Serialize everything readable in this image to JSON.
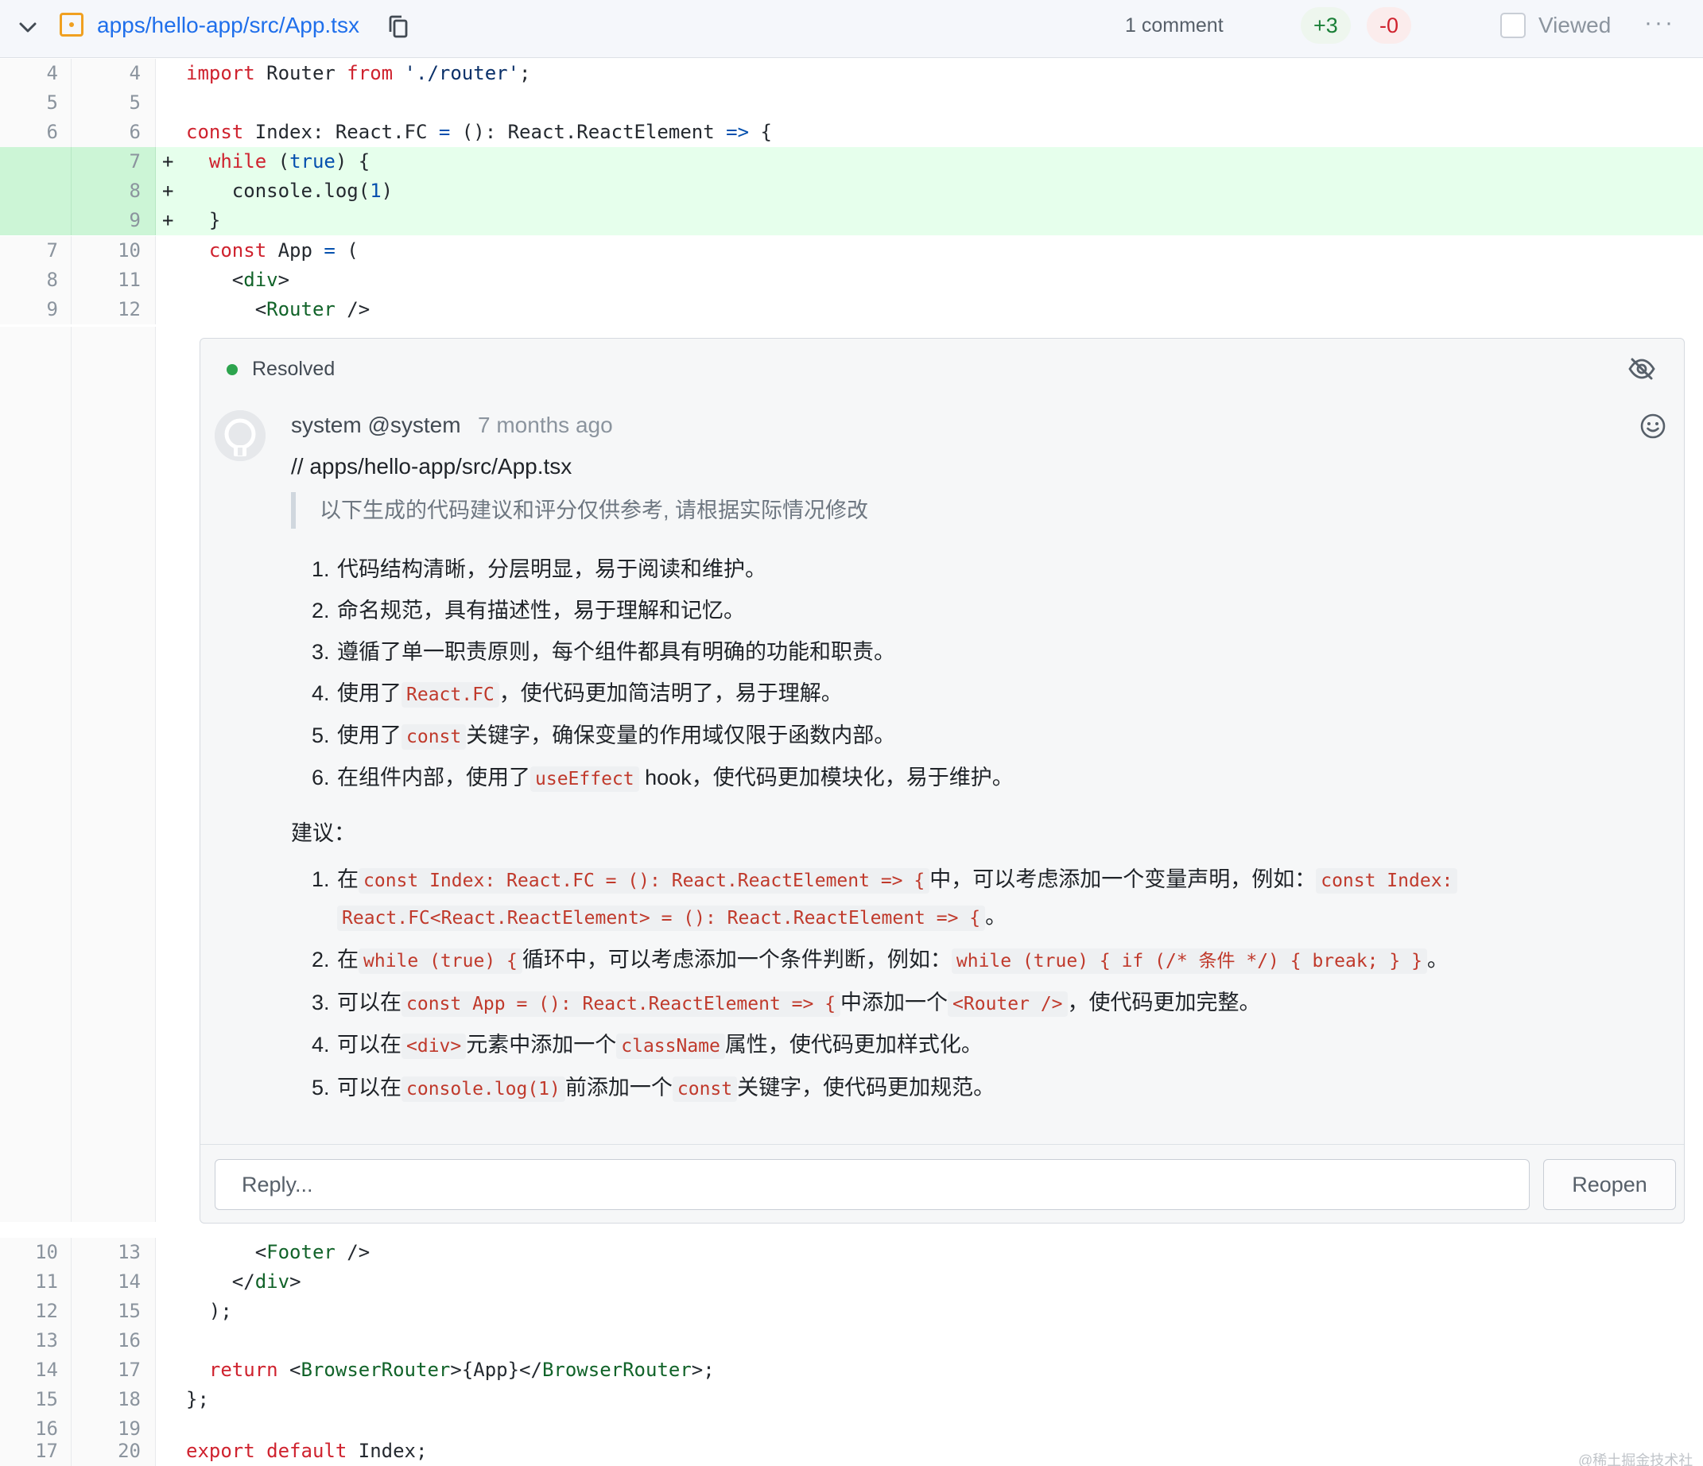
{
  "header": {
    "file_path": "apps/hello-app/src/App.tsx",
    "comments": "1 comment",
    "additions": "+3",
    "deletions": "-0",
    "viewed_label": "Viewed",
    "more": "···"
  },
  "code_top": [
    {
      "old": "4",
      "new": "4",
      "marker": "",
      "type": "ctx"
    },
    {
      "old": "5",
      "new": "5",
      "marker": "",
      "type": "ctx"
    },
    {
      "old": "6",
      "new": "6",
      "marker": "",
      "type": "ctx"
    },
    {
      "old": "",
      "new": "7",
      "marker": "+",
      "type": "add"
    },
    {
      "old": "",
      "new": "8",
      "marker": "+",
      "type": "add"
    },
    {
      "old": "",
      "new": "9",
      "marker": "+",
      "type": "add"
    },
    {
      "old": "7",
      "new": "10",
      "marker": "",
      "type": "ctx"
    },
    {
      "old": "8",
      "new": "11",
      "marker": "",
      "type": "ctx"
    },
    {
      "old": "9",
      "new": "12",
      "marker": "",
      "type": "ctx"
    }
  ],
  "code_bottom": [
    {
      "old": "10",
      "new": "13"
    },
    {
      "old": "11",
      "new": "14"
    },
    {
      "old": "12",
      "new": "15"
    },
    {
      "old": "13",
      "new": "16"
    },
    {
      "old": "14",
      "new": "17"
    },
    {
      "old": "15",
      "new": "18"
    },
    {
      "old": "16",
      "new": "19"
    },
    {
      "old": "17",
      "new": "20"
    }
  ],
  "code_text": {
    "l4": {
      "a": "import",
      "b": " Router ",
      "c": "from",
      "d": " './router'",
      "e": ";"
    },
    "l6": {
      "a": "const",
      "b": " Index: React.FC ",
      "c": "=",
      "d": " (): React.ReactElement ",
      "e": "=>",
      "f": " {"
    },
    "l7": {
      "a": "  ",
      "b": "while",
      "c": " (",
      "d": "true",
      "e": ") {"
    },
    "l8": {
      "a": "    console.log(",
      "b": "1",
      "c": ")"
    },
    "l9": {
      "a": "  }"
    },
    "l10": {
      "a": "  ",
      "b": "const",
      "c": " App ",
      "d": "=",
      "e": " ("
    },
    "l11": {
      "a": "    <",
      "b": "div",
      "c": ">"
    },
    "l12": {
      "a": "      <",
      "b": "Router",
      "c": " />"
    },
    "l13": {
      "a": "      <",
      "b": "Footer",
      "c": " />"
    },
    "l14": {
      "a": "    </",
      "b": "div",
      "c": ">"
    },
    "l15": {
      "a": "  );"
    },
    "l16": {
      "a": ""
    },
    "l17": {
      "a": "  ",
      "b": "return",
      "c": " <",
      "d": "BrowserRouter",
      "e": ">{App}</",
      "f": "BrowserRouter",
      "g": ">;"
    },
    "l18": {
      "a": "};"
    },
    "l19": {
      "a": ""
    },
    "l20": {
      "a": "export",
      "b": " ",
      "c": "default",
      "d": " Index;"
    }
  },
  "comment": {
    "status": "Resolved",
    "author": "system @system",
    "time": "7 months ago",
    "path": "// apps/hello-app/src/App.tsx",
    "quote": "以下生成的代码建议和评分仅供参考, 请根据实际情况修改",
    "points": [
      {
        "n": "1.",
        "t1": "代码结构清晰，分层明显，易于阅读和维护。"
      },
      {
        "n": "2.",
        "t1": "命名规范，具有描述性，易于理解和记忆。"
      },
      {
        "n": "3.",
        "t1": "遵循了单一职责原则，每个组件都具有明确的功能和职责。"
      },
      {
        "n": "4.",
        "t1": "使用了",
        "c1": "React.FC",
        "t2": "，使代码更加简洁明了，易于理解。"
      },
      {
        "n": "5.",
        "t1": "使用了",
        "c1": "const",
        "t2": "关键字，确保变量的作用域仅限于函数内部。"
      },
      {
        "n": "6.",
        "t1": "在组件内部，使用了",
        "c1": "useEffect",
        "t2": "hook，使代码更加模块化，易于维护。"
      }
    ],
    "suggest_title": "建议：",
    "suggestions": [
      {
        "n": "1.",
        "t1": "在",
        "c1": "const Index: React.FC = (): React.ReactElement => {",
        "t2": "中，可以考虑添加一个变量声明，例如：",
        "c2": "const Index:",
        "c3": "React.FC<React.ReactElement> = (): React.ReactElement => {",
        "t3": "。"
      },
      {
        "n": "2.",
        "t1": "在",
        "c1": "while (true) {",
        "t2": "循环中，可以考虑添加一个条件判断，例如：",
        "c2": "while (true) { if (/* 条件 */) { break; } }",
        "t3": "。"
      },
      {
        "n": "3.",
        "t1": "可以在",
        "c1": "const App = (): React.ReactElement => {",
        "t2": "中添加一个",
        "c2": "<Router />",
        "t3": "，使代码更加完整。"
      },
      {
        "n": "4.",
        "t1": "可以在",
        "c1": "<div>",
        "t2": "元素中添加一个",
        "c2": "className",
        "t3": "属性，使代码更加样式化。"
      },
      {
        "n": "5.",
        "t1": "可以在",
        "c1": "console.log(1)",
        "t2": "前添加一个",
        "c2": "const",
        "t3": "关键字，使代码更加规范。"
      }
    ],
    "reply_placeholder": "Reply...",
    "reopen_label": "Reopen"
  },
  "watermark": "@稀土掘金技术社区"
}
